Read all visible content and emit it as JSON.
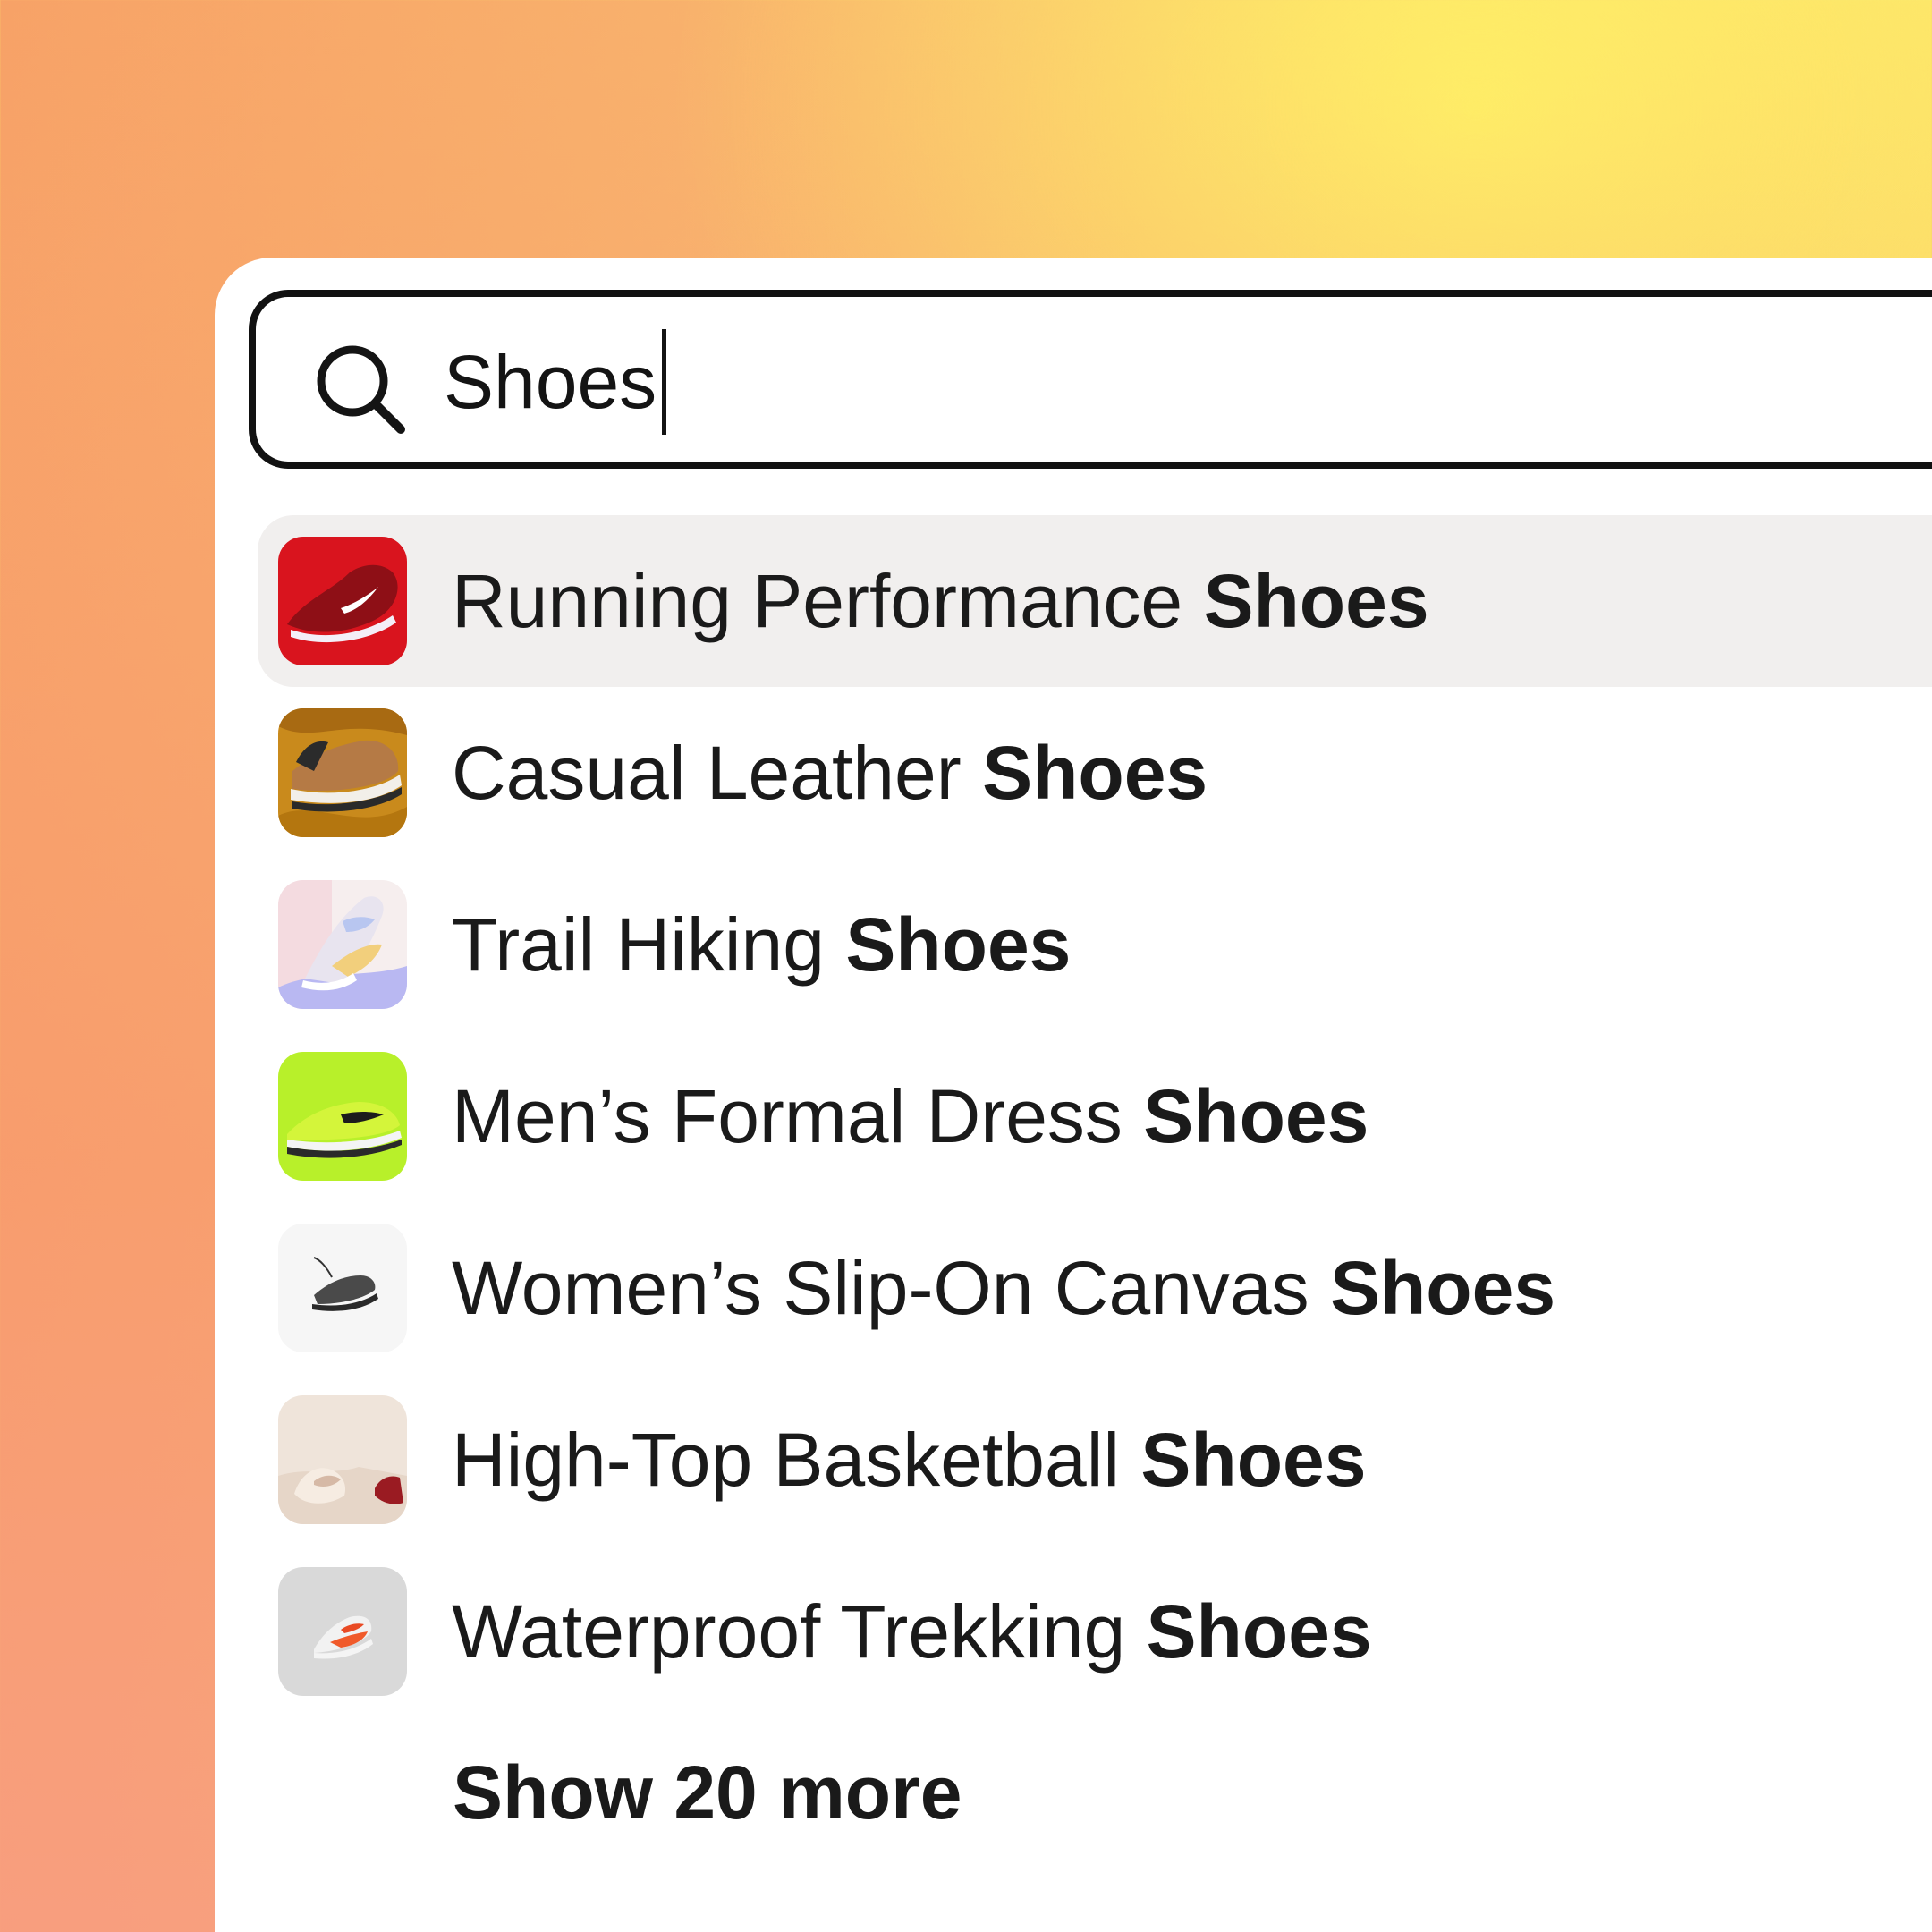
{
  "search": {
    "value": "Shoes",
    "icon": "search-icon"
  },
  "results": [
    {
      "prefix": "Running Performance",
      "match": "Shoes",
      "thumb": "red-running-shoe",
      "highlighted": true
    },
    {
      "prefix": "Casual Leather",
      "match": "Shoes",
      "thumb": "tan-leather-sneaker",
      "highlighted": false
    },
    {
      "prefix": "Trail Hiking",
      "match": "Shoes",
      "thumb": "pastel-sneaker",
      "highlighted": false
    },
    {
      "prefix": "Men’s Formal Dress",
      "match": "Shoes",
      "thumb": "lime-sneaker",
      "highlighted": false
    },
    {
      "prefix": "Women’s Slip-On Canvas",
      "match": "Shoes",
      "thumb": "black-sneaker",
      "highlighted": false
    },
    {
      "prefix": "High-Top Basketball",
      "match": "Shoes",
      "thumb": "beige-bow-shoe",
      "highlighted": false
    },
    {
      "prefix": "Waterproof Trekking",
      "match": "Shoes",
      "thumb": "white-orange-sneaker",
      "highlighted": false
    }
  ],
  "show_more_label": "Show 20 more",
  "colors": {
    "highlight_bg": "#f1efee",
    "text": "#1a1a1a",
    "border": "#111111"
  }
}
